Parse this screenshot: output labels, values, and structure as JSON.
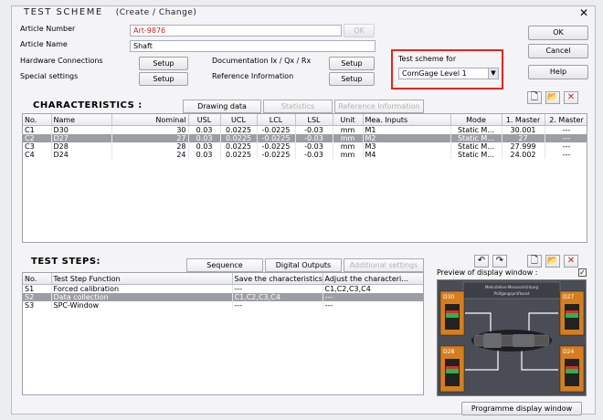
{
  "window": {
    "title": "TEST SCHEME",
    "subtitle": "(Create / Change)",
    "close_icon": "close-icon"
  },
  "form": {
    "article_number_label": "Article Number",
    "article_number_value": "Art-9876",
    "article_name_label": "Article Name",
    "article_name_value": "Shaft",
    "hardware_label": "Hardware Connections",
    "special_label": "Special settings",
    "doc_label": "Documentation Ix / Qx / Rx",
    "ref_label": "Reference Information",
    "setup_label": "Setup",
    "ok_small": "OK",
    "test_scheme_for_label": "Test scheme for",
    "test_scheme_for_value": "ComGage Level 1"
  },
  "buttons": {
    "ok": "OK",
    "cancel": "Cancel",
    "help": "Help",
    "programme": "Programme display window"
  },
  "colors": {
    "article_number": "#d0201c",
    "highlight_box": "#e8241a",
    "selected_row": "#9c9ea6"
  },
  "characteristics": {
    "heading": "CHARACTERISTICS :",
    "tabs": [
      "Drawing data",
      "Statistics",
      "Reference Information"
    ],
    "columns": [
      "No.",
      "Name",
      "Nominal",
      "USL",
      "UCL",
      "LCL",
      "LSL",
      "Unit",
      "Mea. Inputs",
      "Mode",
      "1. Master",
      "2. Master"
    ],
    "rows": [
      [
        "C1",
        "D30",
        "30",
        "0.03",
        "0.0225",
        "-0.0225",
        "-0.03",
        "mm",
        "M1",
        "Static M...",
        "30.001",
        "---"
      ],
      [
        "C2",
        "D27",
        "27",
        "0.03",
        "0.0225",
        "-0.0225",
        "-0.03",
        "mm",
        "M2",
        "Static M...",
        "27",
        "---"
      ],
      [
        "C3",
        "D28",
        "28",
        "0.03",
        "0.0225",
        "-0.0225",
        "-0.03",
        "mm",
        "M3",
        "Static M...",
        "27.999",
        "---"
      ],
      [
        "C4",
        "D24",
        "24",
        "0.03",
        "0.0225",
        "-0.0225",
        "-0.03",
        "mm",
        "M4",
        "Static M...",
        "24.002",
        "---"
      ]
    ]
  },
  "steps": {
    "heading": "TEST STEPS:",
    "tabs": [
      "Sequence",
      "Digital Outputs",
      "Additional settings"
    ],
    "columns": [
      "No.",
      "Test Step Function",
      "Save the characteristics",
      "Adjust the characteri..."
    ],
    "rows": [
      [
        "S1",
        "Forced calibration",
        "---",
        "C1,C2,C3,C4"
      ],
      [
        "S2",
        "Data collection",
        "C1,C2,C3,C4",
        "---"
      ],
      [
        "S3",
        "SPC-Window",
        "---",
        "---"
      ]
    ]
  },
  "preview": {
    "label": "Preview of display window :",
    "checked": true,
    "header_line1": "Mehrstellen-Messvorrichtung",
    "header_line2": "Prüfgangsprüfkunst",
    "gauges": [
      "D30",
      "D27",
      "D28",
      "D24"
    ]
  }
}
